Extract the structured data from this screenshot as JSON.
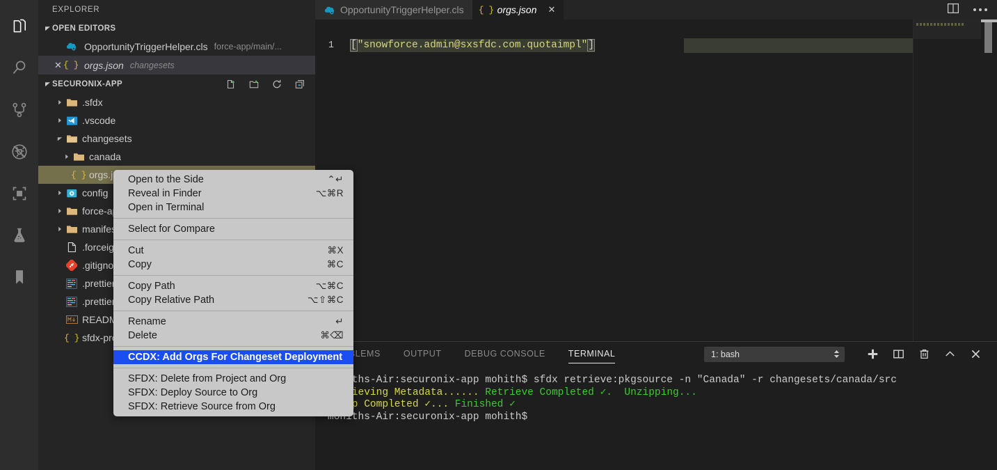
{
  "activity_bar": {
    "items": [
      {
        "name": "explorer-icon",
        "label": "Explorer",
        "active": true
      },
      {
        "name": "search-icon",
        "label": "Search",
        "active": false
      },
      {
        "name": "source-control-icon",
        "label": "Source Control",
        "active": false
      },
      {
        "name": "run-and-debug-icon",
        "label": "Run and Debug",
        "active": false
      },
      {
        "name": "extensions-icon",
        "label": "Extensions",
        "active": false
      },
      {
        "name": "testing-beaker-icon",
        "label": "Testing",
        "active": false
      },
      {
        "name": "bookmarks-icon",
        "label": "Bookmarks",
        "active": false
      }
    ]
  },
  "sidebar": {
    "title": "EXPLORER",
    "open_editors": {
      "header": "OPEN EDITORS",
      "items": [
        {
          "name": "OpportunityTriggerHelper.cls",
          "description": "force-app/main/...",
          "icon": "apex-cloud-icon",
          "dirty": false,
          "selected": false,
          "italic": false
        },
        {
          "name": "orgs.json",
          "description": "changesets",
          "icon": "json-braces-icon",
          "dirty": false,
          "selected": true,
          "italic": true
        }
      ]
    },
    "project": {
      "header": "SECURONIX-APP",
      "actions": [
        "new-file-icon",
        "new-folder-icon",
        "refresh-icon",
        "collapse-all-icon"
      ],
      "tree": [
        {
          "label": ".sfdx",
          "icon": "folder-icon",
          "depth": 1,
          "twisty": "collapsed",
          "selected": false
        },
        {
          "label": ".vscode",
          "icon": "vscode-folder-icon",
          "depth": 1,
          "twisty": "collapsed",
          "selected": false
        },
        {
          "label": "changesets",
          "icon": "folder-open-icon",
          "depth": 1,
          "twisty": "expanded",
          "selected": false
        },
        {
          "label": "canada",
          "icon": "folder-icon",
          "depth": 2,
          "twisty": "collapsed",
          "selected": false
        },
        {
          "label": "orgs.json",
          "icon": "json-braces-icon",
          "depth": 2,
          "twisty": "none",
          "selected": true
        },
        {
          "label": "config",
          "icon": "config-folder-icon",
          "depth": 1,
          "twisty": "collapsed",
          "selected": false
        },
        {
          "label": "force-app",
          "icon": "folder-icon",
          "depth": 1,
          "twisty": "collapsed",
          "selected": false
        },
        {
          "label": "manifest",
          "icon": "folder-icon",
          "depth": 1,
          "twisty": "collapsed",
          "selected": false
        },
        {
          "label": ".forceignore",
          "icon": "file-icon",
          "depth": 1,
          "twisty": "none",
          "selected": false
        },
        {
          "label": ".gitignore",
          "icon": "git-icon",
          "depth": 1,
          "twisty": "none",
          "selected": false
        },
        {
          "label": ".prettierignore",
          "icon": "prettier-icon",
          "depth": 1,
          "twisty": "none",
          "selected": false
        },
        {
          "label": ".prettierrc",
          "icon": "prettier-icon",
          "depth": 1,
          "twisty": "none",
          "selected": false
        },
        {
          "label": "README.md",
          "icon": "markdown-icon",
          "depth": 1,
          "twisty": "none",
          "selected": false
        },
        {
          "label": "sfdx-project.json",
          "icon": "json-braces-icon",
          "depth": 1,
          "twisty": "none",
          "selected": false
        }
      ]
    }
  },
  "editor": {
    "tabs": [
      {
        "label": "OpportunityTriggerHelper.cls",
        "icon": "apex-cloud-icon",
        "active": false,
        "closable": false
      },
      {
        "label": "orgs.json",
        "icon": "json-braces-icon",
        "active": true,
        "closable": true,
        "close_label": "✕"
      }
    ],
    "actions": [
      "split-editor-icon",
      "more-actions-icon"
    ],
    "line_number": "1",
    "code": {
      "open_bracket": "[",
      "string": "\"snowforce.admin@sxsfdc.com.quotaimpl\"",
      "close_bracket": "]",
      "full": "[\"snowforce.admin@sxsfdc.com.quotaimpl\"]"
    }
  },
  "panel": {
    "tabs": [
      {
        "label": "PROBLEMS",
        "active": false
      },
      {
        "label": "OUTPUT",
        "active": false
      },
      {
        "label": "DEBUG CONSOLE",
        "active": false
      },
      {
        "label": "TERMINAL",
        "active": true
      }
    ],
    "terminal_select": "1: bash",
    "actions": [
      {
        "name": "new-terminal-icon",
        "label": "+"
      },
      {
        "name": "split-terminal-icon",
        "label": "Split Terminal"
      },
      {
        "name": "kill-terminal-icon",
        "label": "Kill Terminal"
      },
      {
        "name": "maximize-panel-icon",
        "label": "Maximize Panel Size"
      },
      {
        "name": "close-panel-icon",
        "label": "Close Panel"
      }
    ],
    "terminal_lines": [
      {
        "segments": [
          {
            "text": "mohiths-Air:securonix-app mohith$ sfdx retrieve:pkgsource -n \"Canada\" -r changesets/canada/src",
            "color": "default"
          }
        ]
      },
      {
        "segments": [
          {
            "text": "Retrieving Metadata......",
            "color": "yellow"
          },
          {
            "text": " Retrieve Completed ✓.",
            "color": "green"
          },
          {
            "text": "  Unzipping...",
            "color": "green"
          }
        ]
      },
      {
        "segments": [
          {
            "text": "Unzip Completed ✓...",
            "color": "yellow"
          },
          {
            "text": " Finished ✓",
            "color": "green"
          }
        ]
      },
      {
        "segments": [
          {
            "text": "mohiths-Air:securonix-app mohith$",
            "color": "default"
          }
        ]
      }
    ]
  },
  "context_menu": {
    "groups": [
      {
        "items": [
          {
            "label": "Open to the Side",
            "shortcut": "⌃↵",
            "highlight": false
          },
          {
            "label": "Reveal in Finder",
            "shortcut": "⌥⌘R",
            "highlight": false
          },
          {
            "label": "Open in Terminal",
            "shortcut": "",
            "highlight": false
          }
        ]
      },
      {
        "items": [
          {
            "label": "Select for Compare",
            "shortcut": "",
            "highlight": false
          }
        ]
      },
      {
        "items": [
          {
            "label": "Cut",
            "shortcut": "⌘X",
            "highlight": false
          },
          {
            "label": "Copy",
            "shortcut": "⌘C",
            "highlight": false
          }
        ]
      },
      {
        "items": [
          {
            "label": "Copy Path",
            "shortcut": "⌥⌘C",
            "highlight": false
          },
          {
            "label": "Copy Relative Path",
            "shortcut": "⌥⇧⌘C",
            "highlight": false
          }
        ]
      },
      {
        "items": [
          {
            "label": "Rename",
            "shortcut": "↵",
            "highlight": false
          },
          {
            "label": "Delete",
            "shortcut": "⌘⌫",
            "highlight": false
          }
        ]
      },
      {
        "items": [
          {
            "label": "CCDX: Add Orgs For Changeset Deployment",
            "shortcut": "",
            "highlight": true
          }
        ]
      },
      {
        "items": [
          {
            "label": "SFDX: Delete from Project and Org",
            "shortcut": "",
            "highlight": false
          },
          {
            "label": "SFDX: Deploy Source to Org",
            "shortcut": "",
            "highlight": false
          },
          {
            "label": "SFDX: Retrieve Source from Org",
            "shortcut": "",
            "highlight": false
          }
        ]
      }
    ]
  },
  "colors": {
    "accent_blue": "#1b4ef0",
    "selection_olive": "#75704c",
    "editor_bg": "#1e1e1e",
    "sidebar_bg": "#252526",
    "menu_bg": "#c8c8c8",
    "terminal_green": "#3ec930",
    "terminal_yellow": "#d7d74a",
    "json_string": "#d7d782"
  }
}
